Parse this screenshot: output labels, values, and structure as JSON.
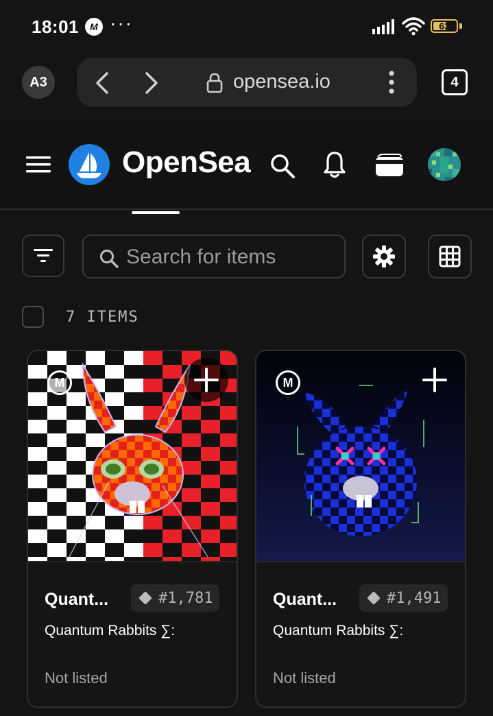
{
  "status_bar": {
    "time": "18:01",
    "app_icon_letter": "M",
    "dots": "···",
    "battery_level": 63,
    "battery_label": "63"
  },
  "browser": {
    "profile_label": "A3",
    "url": "opensea.io",
    "tab_count": "4"
  },
  "site_header": {
    "brand_name": "OpenSea",
    "brand_color": "#2081e2"
  },
  "toolbar": {
    "search_placeholder": "Search for items"
  },
  "items": {
    "count_label": "7 ITEMS",
    "cards": [
      {
        "name": "Quant...",
        "token_id": "#1,781",
        "collection": "Quantum Rabbits ∑:",
        "status": "Not listed",
        "badge": "M"
      },
      {
        "name": "Quant...",
        "token_id": "#1,491",
        "collection": "Quantum Rabbits ∑:",
        "status": "Not listed",
        "badge": "M"
      }
    ]
  }
}
